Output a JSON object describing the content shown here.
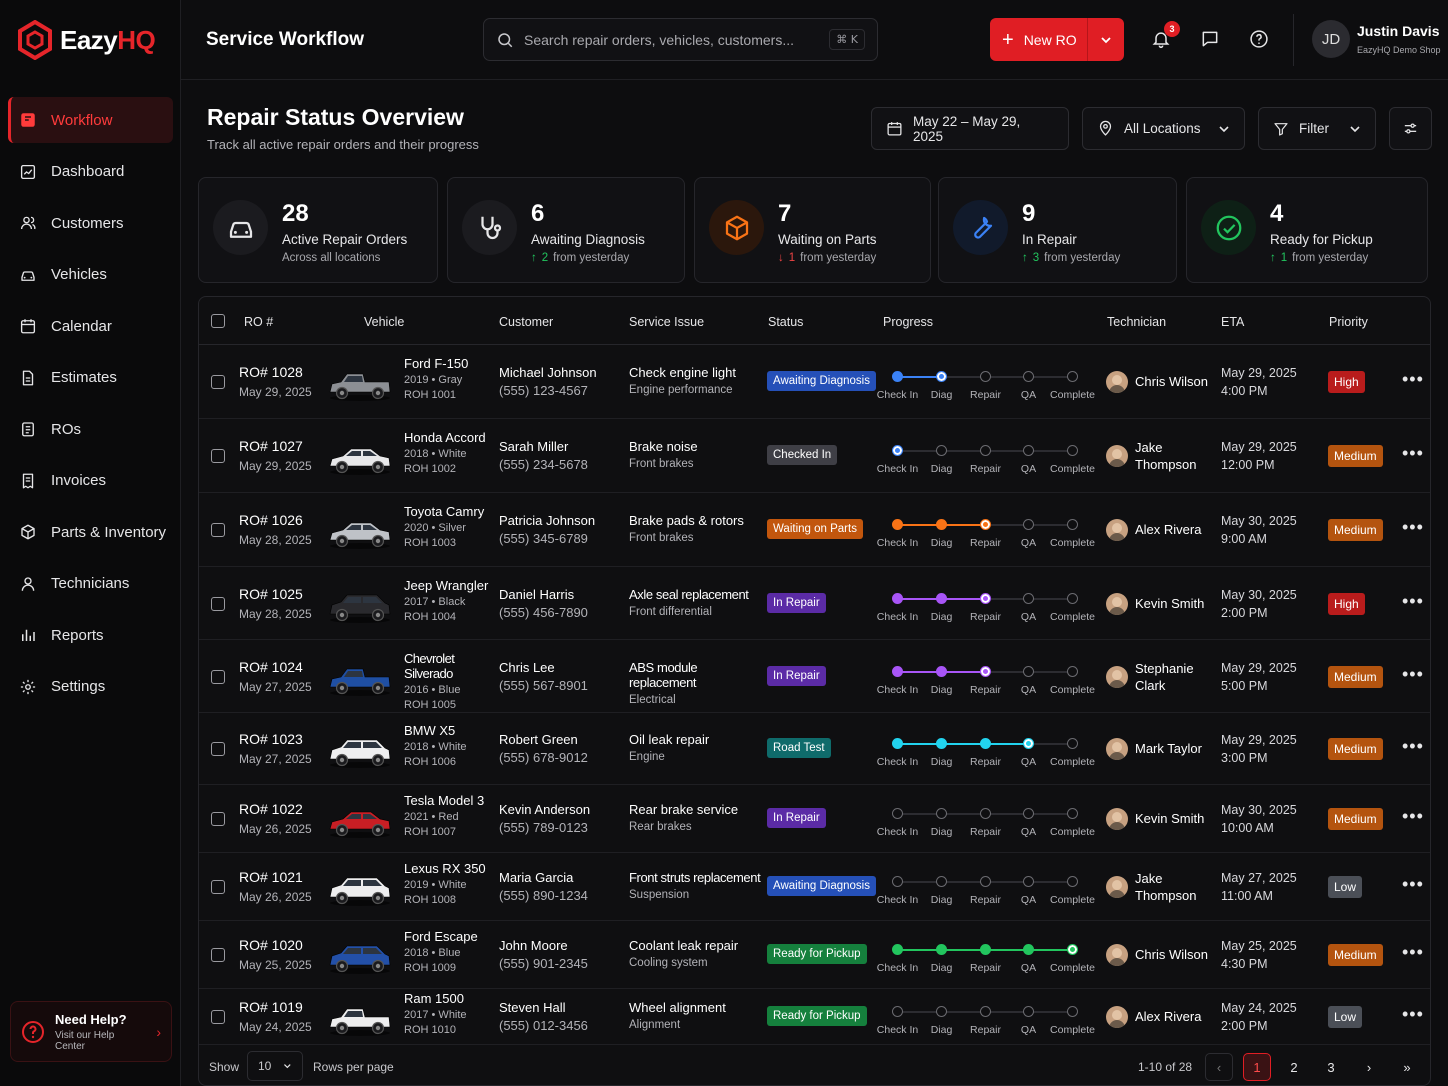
{
  "brand": {
    "name_part1": "Eazy",
    "name_part2": "HQ",
    "accent": "#e5252a"
  },
  "header": {
    "title": "Service Workflow",
    "search_placeholder": "Search repair orders, vehicles, customers...",
    "search_shortcut": "⌘ K",
    "new_ro_label": "New RO",
    "notifications_count": "3",
    "user": {
      "initials": "JD",
      "name": "Justin Davis",
      "org": "EazyHQ Demo Shop"
    }
  },
  "sidebar": {
    "items": [
      {
        "label": "Workflow",
        "icon": "workflow-icon",
        "active": true
      },
      {
        "label": "Dashboard",
        "icon": "dashboard-icon"
      },
      {
        "label": "Customers",
        "icon": "customers-icon"
      },
      {
        "label": "Vehicles",
        "icon": "car-icon"
      },
      {
        "label": "Calendar",
        "icon": "calendar-icon"
      },
      {
        "label": "Estimates",
        "icon": "document-icon"
      },
      {
        "label": "ROs",
        "icon": "clipboard-icon"
      },
      {
        "label": "Invoices",
        "icon": "invoice-icon"
      },
      {
        "label": "Parts & Inventory",
        "icon": "box-icon"
      },
      {
        "label": "Technicians",
        "icon": "technician-icon"
      },
      {
        "label": "Reports",
        "icon": "chart-icon"
      },
      {
        "label": "Settings",
        "icon": "gear-icon"
      }
    ],
    "help": {
      "title": "Need Help?",
      "subtitle": "Visit our Help Center"
    }
  },
  "page": {
    "title": "Repair Status Overview",
    "subtitle": "Track all active repair orders and their progress",
    "date_range": "May 22 – May 29, 2025",
    "location": "All Locations",
    "filter_label": "Filter"
  },
  "stats": [
    {
      "value": "28",
      "label": "Active Repair Orders",
      "sub": "Across all locations",
      "trend": "",
      "delta": "",
      "icon": "car-icon",
      "color": "#e6e6e8",
      "bg": "#1b1b1f"
    },
    {
      "value": "6",
      "label": "Awaiting Diagnosis",
      "sub": "from yesterday",
      "trend": "up",
      "delta": "2",
      "icon": "stethoscope-icon",
      "color": "#e6e6e8",
      "bg": "#1b1b1f"
    },
    {
      "value": "7",
      "label": "Waiting on Parts",
      "sub": "from yesterday",
      "trend": "down",
      "delta": "1",
      "icon": "box-icon",
      "color": "#f97316",
      "bg": "#2b170c"
    },
    {
      "value": "9",
      "label": "In Repair",
      "sub": "from yesterday",
      "trend": "up",
      "delta": "3",
      "icon": "wrench-icon",
      "color": "#3b82f6",
      "bg": "#111a2b"
    },
    {
      "value": "4",
      "label": "Ready for Pickup",
      "sub": "from yesterday",
      "trend": "up",
      "delta": "1",
      "icon": "check-circle-icon",
      "color": "#22c55e",
      "bg": "#0e2016"
    }
  ],
  "table": {
    "columns": [
      "RO #",
      "Vehicle",
      "Customer",
      "Service Issue",
      "Status",
      "Progress",
      "Technician",
      "ETA",
      "Priority"
    ],
    "steps": [
      "Check In",
      "Diag",
      "Repair",
      "QA",
      "Complete"
    ],
    "rows": [
      {
        "ro": "RO# 1028",
        "date": "May 29, 2025",
        "vehicle": "Ford F-150",
        "vsub": "2019 • Gray",
        "vro": "ROH 1001",
        "car_color": "#8c8f94",
        "car_type": "truck",
        "customer": "Michael Johnson",
        "phone": "(555) 123-4567",
        "issue": "Check engine light",
        "issue_sub": "Engine performance",
        "status": "Awaiting Diagnosis",
        "status_color": "#2550b8",
        "progress_step": 1,
        "progress_color": "#3b82f6",
        "tech": "Chris Wilson",
        "tech2": "",
        "eta": "May 29, 2025",
        "eta_time": "4:00 PM",
        "priority": "High",
        "prio_color": "#b91c1c"
      },
      {
        "ro": "RO# 1027",
        "date": "May 29, 2025",
        "vehicle": "Honda Accord",
        "vsub": "2018 • White",
        "vro": "ROH 1002",
        "car_color": "#e8e8ea",
        "car_type": "sedan",
        "customer": "Sarah Miller",
        "phone": "(555) 234-5678",
        "issue": "Brake noise",
        "issue_sub": "Front brakes",
        "status": "Checked In",
        "status_color": "#3f3f46",
        "progress_step": 0,
        "progress_color": "#3b82f6",
        "tech": "Jake",
        "tech2": "Thompson",
        "eta": "May 29, 2025",
        "eta_time": "12:00 PM",
        "priority": "Medium",
        "prio_color": "#b4540f"
      },
      {
        "ro": "RO# 1026",
        "date": "May 28, 2025",
        "vehicle": "Toyota Camry",
        "vsub": "2020 • Silver",
        "vro": "ROH 1003",
        "car_color": "#bfc2c7",
        "car_type": "sedan",
        "customer": "Patricia Johnson",
        "phone": "(555) 345-6789",
        "issue": "Brake pads & rotors",
        "issue_sub": "Front brakes",
        "status": "Waiting on Parts",
        "status_color": "#c2560d",
        "progress_step": 2,
        "progress_color": "#f97316",
        "tech": "Alex Rivera",
        "tech2": "",
        "eta": "May 30, 2025",
        "eta_time": "9:00 AM",
        "priority": "Medium",
        "prio_color": "#b4540f"
      },
      {
        "ro": "RO# 1025",
        "date": "May 28, 2025",
        "vehicle": "Jeep Wrangler",
        "vsub": "2017 • Black",
        "vro": "ROH 1004",
        "car_color": "#2a2a2e",
        "car_type": "suv",
        "customer": "Daniel Harris",
        "phone": "(555) 456-7890",
        "issue": "Axle seal replacement",
        "issue_sub": "Front differential",
        "status": "In Repair",
        "status_color": "#5b2ba6",
        "progress_step": 2,
        "progress_color": "#a855f7",
        "tech": "Kevin Smith",
        "tech2": "",
        "eta": "May 30, 2025",
        "eta_time": "2:00 PM",
        "priority": "High",
        "prio_color": "#b91c1c"
      },
      {
        "ro": "RO# 1024",
        "date": "May 27, 2025",
        "vehicle": "Chevrolet Silverado",
        "vsub": "2016 • Blue",
        "vro": "ROH 1005",
        "car_color": "#1f4fa3",
        "car_type": "truck",
        "customer": "Chris Lee",
        "phone": "(555) 567-8901",
        "issue": "ABS module replacement",
        "issue_sub": "Electrical",
        "status": "In Repair",
        "status_color": "#5b2ba6",
        "progress_step": 2,
        "progress_color": "#a855f7",
        "tech": "Stephanie",
        "tech2": "Clark",
        "eta": "May 29, 2025",
        "eta_time": "5:00 PM",
        "priority": "Medium",
        "prio_color": "#b4540f"
      },
      {
        "ro": "RO# 1023",
        "date": "May 27, 2025",
        "vehicle": "BMW X5",
        "vsub": "2018 • White",
        "vro": "ROH 1006",
        "car_color": "#eeeeef",
        "car_type": "suv",
        "customer": "Robert Green",
        "phone": "(555) 678-9012",
        "issue": "Oil leak repair",
        "issue_sub": "Engine",
        "status": "Road Test",
        "status_color": "#0f6b6b",
        "progress_step": 3,
        "progress_color": "#22d3ee",
        "tech": "Mark Taylor",
        "tech2": "",
        "eta": "May 29, 2025",
        "eta_time": "3:00 PM",
        "priority": "Medium",
        "prio_color": "#b4540f"
      },
      {
        "ro": "RO# 1022",
        "date": "May 26, 2025",
        "vehicle": "Tesla Model 3",
        "vsub": "2021 • Red",
        "vro": "ROH 1007",
        "car_color": "#c81e24",
        "car_type": "sedan",
        "customer": "Kevin Anderson",
        "phone": "(555) 789-0123",
        "issue": "Rear brake service",
        "issue_sub": "Rear brakes",
        "status": "In Repair",
        "status_color": "#5b2ba6",
        "progress_step": -1,
        "progress_color": "#a855f7",
        "tech": "Kevin Smith",
        "tech2": "",
        "eta": "May 30, 2025",
        "eta_time": "10:00 AM",
        "priority": "Medium",
        "prio_color": "#b4540f"
      },
      {
        "ro": "RO# 1021",
        "date": "May 26, 2025",
        "vehicle": "Lexus RX 350",
        "vsub": "2019 • White",
        "vro": "ROH 1008",
        "car_color": "#eeeeef",
        "car_type": "suv",
        "customer": "Maria Garcia",
        "phone": "(555) 890-1234",
        "issue": "Front struts replacement",
        "issue_sub": "Suspension",
        "status": "Awaiting Diagnosis",
        "status_color": "#2550b8",
        "progress_step": -1,
        "progress_color": "#3b82f6",
        "tech": "Jake",
        "tech2": "Thompson",
        "eta": "May 27, 2025",
        "eta_time": "11:00 AM",
        "priority": "Low",
        "prio_color": "#4b4f57"
      },
      {
        "ro": "RO# 1020",
        "date": "May 25, 2025",
        "vehicle": "Ford Escape",
        "vsub": "2018 • Blue",
        "vro": "ROH 1009",
        "car_color": "#2350a8",
        "car_type": "suv",
        "customer": "John Moore",
        "phone": "(555) 901-2345",
        "issue": "Coolant leak repair",
        "issue_sub": "Cooling system",
        "status": "Ready for Pickup",
        "status_color": "#15803d",
        "progress_step": 4,
        "progress_color": "#22c55e",
        "tech": "Chris Wilson",
        "tech2": "",
        "eta": "May 25, 2025",
        "eta_time": "4:30 PM",
        "priority": "Medium",
        "prio_color": "#b4540f"
      },
      {
        "ro": "RO# 1019",
        "date": "May 24, 2025",
        "vehicle": "Ram 1500",
        "vsub": "2017 • White",
        "vro": "ROH 1010",
        "car_color": "#eeeeef",
        "car_type": "truck",
        "customer": "Steven Hall",
        "phone": "(555) 012-3456",
        "issue": "Wheel alignment",
        "issue_sub": "Alignment",
        "status": "Ready for Pickup",
        "status_color": "#15803d",
        "progress_step": -1,
        "progress_color": "#22c55e",
        "tech": "Alex Rivera",
        "tech2": "",
        "eta": "May 24, 2025",
        "eta_time": "2:00 PM",
        "priority": "Low",
        "prio_color": "#4b4f57"
      }
    ]
  },
  "footer": {
    "show_label": "Show",
    "page_size": "10",
    "rows_label": "Rows per page",
    "range": "1-10 of 28",
    "pages": [
      "1",
      "2",
      "3"
    ],
    "current_page": "1"
  }
}
